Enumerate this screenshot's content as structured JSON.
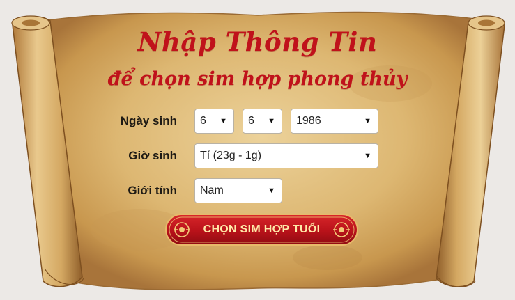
{
  "form": {
    "title_line1": "Nhập Thông Tin",
    "title_line2": "để chọn sim hợp phong thủy",
    "birth_date": {
      "label": "Ngày sinh",
      "day": "6",
      "month": "6",
      "year": "1986"
    },
    "birth_hour": {
      "label": "Giờ sinh",
      "value": "Tí (23g - 1g)"
    },
    "gender": {
      "label": "Giới tính",
      "value": "Nam"
    },
    "submit_label": "CHỌN SIM HỢP TUỔI"
  },
  "icons": {
    "caret": "chevron-down-icon",
    "cta_ornament_left": "ornament-icon",
    "cta_ornament_right": "ornament-icon"
  },
  "colors": {
    "title": "#c0121b",
    "button": "#b8121a",
    "button_text": "#ffe9a8",
    "parchment": "#d9b26a"
  }
}
